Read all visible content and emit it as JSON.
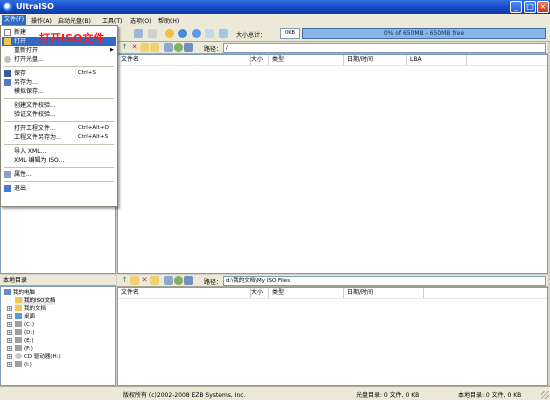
{
  "window": {
    "title": "UltraISO",
    "min_glyph": "_",
    "max_glyph": "□",
    "close_glyph": "×"
  },
  "menubar": {
    "items": [
      "文件(F)",
      "操作(A)",
      "启动光盘(B)",
      "工具(T)",
      "选项(O)",
      "帮助(H)"
    ]
  },
  "toolbar": {
    "size_label": "大小总计：",
    "size_value": "0KB",
    "capacity_text": "0% of 650MB - 650MB free"
  },
  "annotation": "打开ISO文件",
  "file_menu": {
    "items": [
      {
        "label": "新建",
        "shortcut": "",
        "icon": "new-icon"
      },
      {
        "label": "打开",
        "shortcut": "",
        "icon": "open-folder-icon",
        "selected": true
      },
      {
        "label": "重新打开",
        "shortcut": "",
        "submenu": true
      },
      {
        "label": "打开光盘...",
        "shortcut": "",
        "icon": "cd-icon"
      },
      {
        "label": "保存",
        "shortcut": "Ctrl+S",
        "icon": "save-icon"
      },
      {
        "label": "另存为...",
        "shortcut": "",
        "icon": "save-as-icon"
      },
      {
        "label": "模拟保存...",
        "shortcut": ""
      },
      {
        "label": "创建文件校验...",
        "shortcut": ""
      },
      {
        "label": "验证文件校验...",
        "shortcut": ""
      },
      {
        "label": "打开工程文件...",
        "shortcut": "Ctrl+Alt+O"
      },
      {
        "label": "工程文件另存为...",
        "shortcut": "Ctrl+Alt+S"
      },
      {
        "label": "导入 XML...",
        "shortcut": ""
      },
      {
        "label": "XML 编辑为 ISO...",
        "shortcut": ""
      },
      {
        "label": "属性...",
        "shortcut": "",
        "icon": "properties-icon"
      },
      {
        "label": "退出",
        "shortcut": "",
        "icon": "exit-icon"
      }
    ]
  },
  "upper_panel": {
    "path_label": "路径：",
    "path_value": "/",
    "columns": [
      "文件名",
      "大小",
      "类型",
      "日期/时间",
      "LBA"
    ]
  },
  "lower_panel": {
    "title": "本地目录",
    "path_label": "路径：",
    "path_value": "d:\\我的文档\\My ISO Files",
    "columns": [
      "文件名",
      "大小",
      "类型",
      "日期/时间"
    ]
  },
  "tree": {
    "nodes": [
      {
        "label": "我的电脑",
        "level": 0,
        "icon": "computer-icon"
      },
      {
        "label": "我的ISO文档",
        "level": 1,
        "icon": "folder-icon",
        "selected": true
      },
      {
        "label": "我的文档",
        "level": 1,
        "icon": "folder-icon"
      },
      {
        "label": "桌面",
        "level": 1,
        "icon": "desktop-icon"
      },
      {
        "label": "(C:)",
        "level": 1,
        "icon": "drive-icon"
      },
      {
        "label": "(D:)",
        "level": 1,
        "icon": "drive-icon"
      },
      {
        "label": "(E:)",
        "level": 1,
        "icon": "drive-icon"
      },
      {
        "label": "(F:)",
        "level": 1,
        "icon": "drive-icon"
      },
      {
        "label": "CD 驱动器(H:)",
        "level": 1,
        "icon": "cd-drive-icon"
      },
      {
        "label": "(I:)",
        "level": 1,
        "icon": "drive-icon"
      }
    ]
  },
  "status": {
    "copyright": "版权所有 (c)2002-2008 EZB Systems, Inc.",
    "cd_dir": "光盘目录: 0 文件, 0 KB",
    "local_dir": "本地目录: 0 文件, 0 KB"
  }
}
